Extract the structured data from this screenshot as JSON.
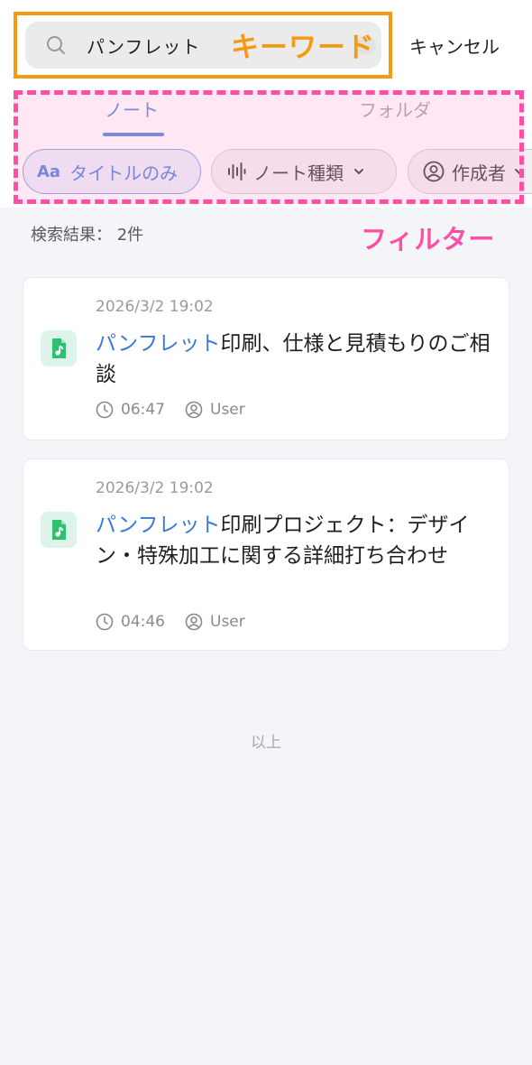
{
  "search": {
    "query": "パンフレット",
    "cancel_label": "キャンセル"
  },
  "annotations": {
    "keyword": "キーワード",
    "filter": "フィルター"
  },
  "tabs": [
    {
      "label": "ノート",
      "active": true
    },
    {
      "label": "フォルダ",
      "active": false
    }
  ],
  "filters": {
    "title_only": {
      "icon": "Aa",
      "label": "タイトルのみ",
      "active": true
    },
    "note_type": {
      "label": "ノート種類"
    },
    "author": {
      "label": "作成者"
    }
  },
  "results": {
    "count_label": "検索結果：  2件",
    "items": [
      {
        "date": "2026/3/2  19:02",
        "highlight": "パンフレット",
        "title_rest": "印刷、仕様と見積もりのご相談",
        "duration": "06:47",
        "user": "User"
      },
      {
        "date": "2026/3/2  19:02",
        "highlight": "パンフレット",
        "title_rest": "印刷プロジェクト：デザイン・特殊加工に関する詳細打ち合わせ",
        "duration": "04:46",
        "user": "User"
      }
    ],
    "end_label": "以上"
  },
  "colors": {
    "accent": "#3b78d8",
    "keyword_annotation": "#f39a12",
    "filter_annotation": "#ff4fa5",
    "file_icon": "#2fbf71"
  }
}
